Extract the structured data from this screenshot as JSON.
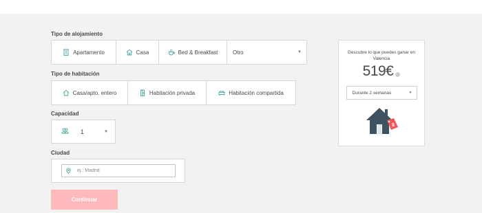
{
  "form": {
    "accommodation": {
      "label": "Tipo de alojamiento",
      "options": [
        {
          "label": "Apartamento",
          "icon": "building-icon"
        },
        {
          "label": "Casa",
          "icon": "house-icon"
        },
        {
          "label": "Bed & Breakfast",
          "icon": "breakfast-icon"
        }
      ],
      "other": {
        "label": "Otro"
      }
    },
    "room": {
      "label": "Tipo de habitación",
      "options": [
        {
          "label": "Casa/apto. entero",
          "icon": "house-icon"
        },
        {
          "label": "Habitación privada",
          "icon": "door-icon"
        },
        {
          "label": "Habitación compartida",
          "icon": "sofa-icon"
        }
      ]
    },
    "capacity": {
      "label": "Capacidad",
      "value": "1",
      "icon": "people-icon"
    },
    "city": {
      "label": "Ciudad",
      "placeholder": "ej.: Madrid",
      "icon": "location-pin-icon"
    },
    "continue_label": "Continuar"
  },
  "earnings": {
    "title": "Descubre lo que puedes ganar en Valencia",
    "amount": "519€",
    "period": "Durante 2 semanas"
  },
  "colors": {
    "accent": "#4aa3a0",
    "continue_disabled": "#fdb9bb",
    "house": "#3f5261",
    "tag": "#f2575a"
  }
}
